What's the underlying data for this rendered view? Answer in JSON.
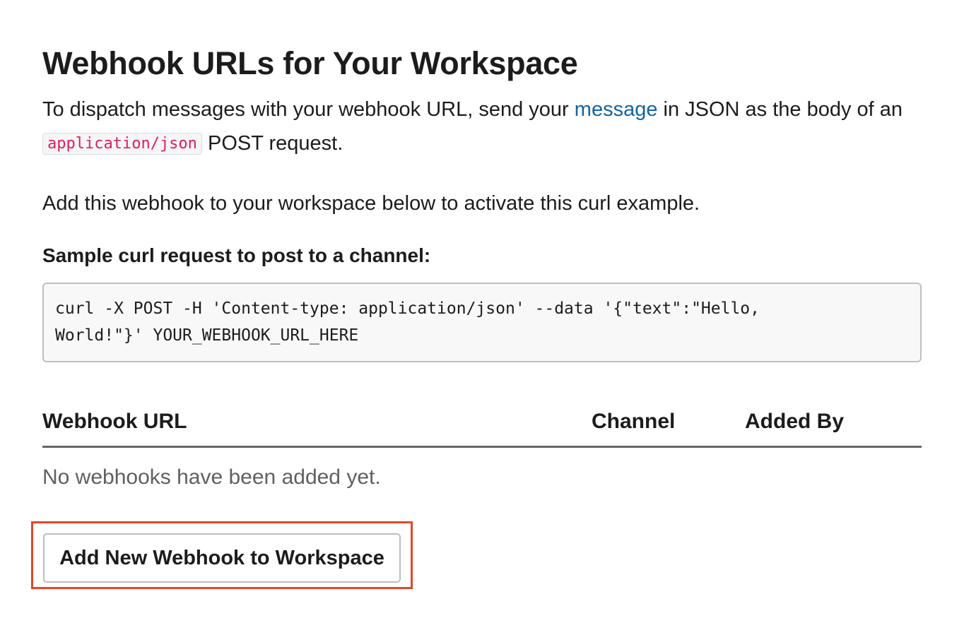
{
  "page": {
    "title": "Webhook URLs for Your Workspace",
    "intro_before_link": "To dispatch messages with your webhook URL, send your ",
    "intro_link": "message",
    "intro_after_link": " in JSON as the body of an ",
    "intro_code": "application/json",
    "intro_end": " POST request.",
    "activate_text": "Add this webhook to your workspace below to activate this curl example.",
    "sample_heading": "Sample curl request to post to a channel:",
    "sample_code": "curl -X POST -H 'Content-type: application/json' --data '{\"text\":\"Hello,\nWorld!\"}' YOUR_WEBHOOK_URL_HERE"
  },
  "table": {
    "columns": [
      "Webhook URL",
      "Channel",
      "Added By"
    ],
    "empty_message": "No webhooks have been added yet."
  },
  "actions": {
    "add_button_label": "Add New Webhook to Workspace"
  },
  "colors": {
    "link": "#1264a3",
    "code_text": "#e01e5a",
    "highlight_border": "#e0482a"
  }
}
